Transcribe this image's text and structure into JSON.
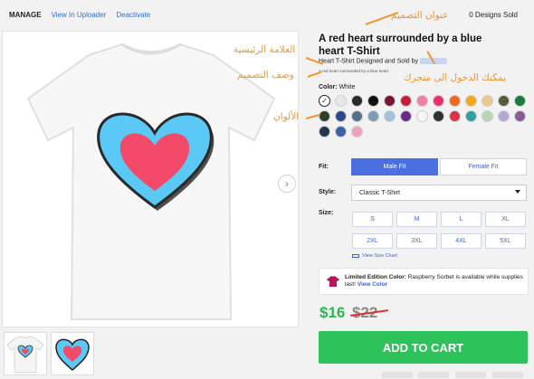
{
  "topbar": {
    "manage": "MANAGE",
    "links": [
      "View In Uploader",
      "Deactivate"
    ],
    "sold": "0 Designs Sold"
  },
  "product": {
    "title": "A red heart surrounded by a blue heart T-Shirt",
    "subline_prefix": "Heart T-Shirt Designed and Sold by",
    "description": "A red heart surrounded by a blue heart.",
    "color_label": "Color:",
    "color_value": "White"
  },
  "swatch_colors": [
    "#ffffff",
    "#e8e8e8",
    "#2a2a2a",
    "#111111",
    "#7a1535",
    "#c41e3a",
    "#f07fa8",
    "#e8336a",
    "#f26522",
    "#f5a81c",
    "#e9c98f",
    "#5a5a3a",
    "#1b7a3e",
    "#2e3f2a",
    "#2b4a8a",
    "#55708f",
    "#7c9db8",
    "#9fc3df",
    "#6a2b8a",
    "#f5f5f5",
    "#303030",
    "#e22f48",
    "#2aa3a0",
    "#b7d9b2",
    "#b0a8d8",
    "#8a5a98",
    "#273653",
    "#3e62a8",
    "#f0a0c0"
  ],
  "fit": {
    "label": "Fit:",
    "options": [
      "Male Fit",
      "Female Fit"
    ]
  },
  "style": {
    "label": "Style:",
    "value": "Classic T-Shirt"
  },
  "size": {
    "label": "Size:",
    "options": [
      "S",
      "M",
      "L",
      "XL",
      "2XL",
      "3XL",
      "4XL",
      "5XL"
    ],
    "chart_link": "View Size Chart"
  },
  "limited": {
    "lead": "Limited Edition Color:",
    "text": "Raspberry Sorbet is available while supplies last!",
    "link": "View Color"
  },
  "price": {
    "current": "$16",
    "old": "$22"
  },
  "cart_label": "ADD TO CART",
  "annotations": {
    "design_title": "عنوان التصميم",
    "brand": "العلامة الرئيسية",
    "design_description": "وصف التصميم",
    "movable": "يمكنك الدخول الى متجرك",
    "colors": "الألوان"
  },
  "colors": {
    "accent": "#4a6fe0",
    "price_green": "#2cb84d",
    "cart_green": "#2ec25a",
    "annotation": "#f0952b",
    "shirt_heart_outer": "#5bc9f5",
    "shirt_heart_inner": "#f24a68"
  }
}
